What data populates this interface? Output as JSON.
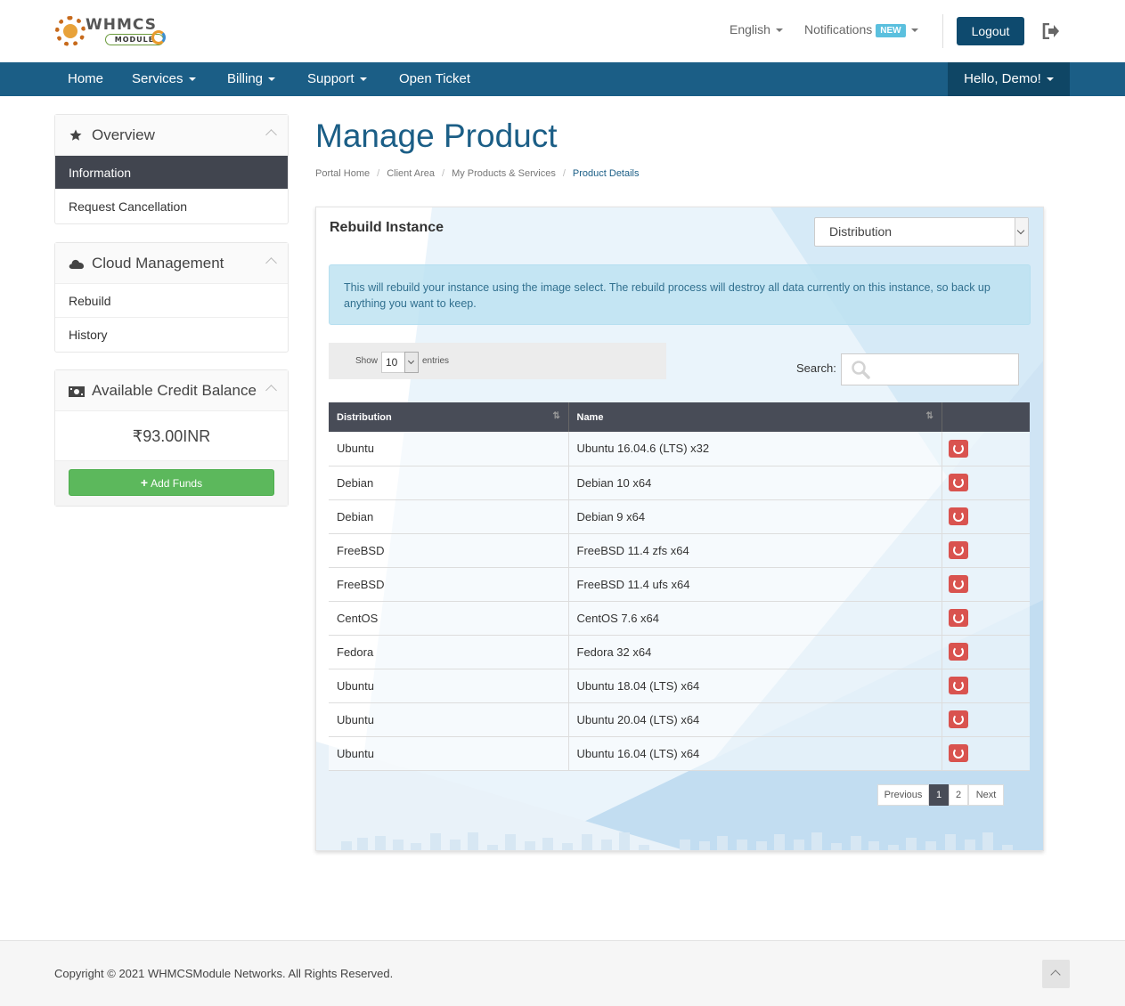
{
  "header": {
    "logo_text": "WHMCS",
    "logo_sub": "MODULE",
    "language": "English",
    "notifications_label": "Notifications",
    "notifications_badge": "NEW",
    "logout_label": "Logout"
  },
  "nav": {
    "items": [
      {
        "label": "Home",
        "dropdown": false
      },
      {
        "label": "Services",
        "dropdown": true
      },
      {
        "label": "Billing",
        "dropdown": true
      },
      {
        "label": "Support",
        "dropdown": true
      },
      {
        "label": "Open Ticket",
        "dropdown": false
      }
    ],
    "user_label": "Hello, Demo!"
  },
  "sidebar": {
    "overview": {
      "title": "Overview",
      "items": [
        "Information",
        "Request Cancellation"
      ],
      "active": "Information"
    },
    "cloud": {
      "title": "Cloud Management",
      "items": [
        "Rebuild",
        "History"
      ]
    },
    "credit": {
      "title": "Available Credit Balance",
      "amount": "₹93.00INR",
      "add_funds_label": "Add Funds"
    }
  },
  "main": {
    "title": "Manage Product",
    "breadcrumb": [
      "Portal Home",
      "Client Area",
      "My Products & Services",
      "Product Details"
    ],
    "card": {
      "title": "Rebuild Instance",
      "distribution_select": "Distribution",
      "alert": "This will rebuild your instance using the image select. The rebuild process will destroy all data currently on this instance, so back up anything you want to keep.",
      "length": {
        "show": "Show",
        "value": "10",
        "entries": "entries"
      },
      "search_label": "Search:",
      "columns": [
        "Distribution",
        "Name",
        ""
      ],
      "rows": [
        {
          "distribution": "Ubuntu",
          "name": "Ubuntu 16.04.6 (LTS) x32"
        },
        {
          "distribution": "Debian",
          "name": "Debian 10 x64"
        },
        {
          "distribution": "Debian",
          "name": "Debian 9 x64"
        },
        {
          "distribution": "FreeBSD",
          "name": "FreeBSD 11.4 zfs x64"
        },
        {
          "distribution": "FreeBSD",
          "name": "FreeBSD 11.4 ufs x64"
        },
        {
          "distribution": "CentOS",
          "name": "CentOS 7.6 x64"
        },
        {
          "distribution": "Fedora",
          "name": "Fedora 32 x64"
        },
        {
          "distribution": "Ubuntu",
          "name": "Ubuntu 18.04 (LTS) x64"
        },
        {
          "distribution": "Ubuntu",
          "name": "Ubuntu 20.04 (LTS) x64"
        },
        {
          "distribution": "Ubuntu",
          "name": "Ubuntu 16.04 (LTS) x64"
        }
      ],
      "pagination": {
        "previous": "Previous",
        "pages": [
          "1",
          "2"
        ],
        "current": "1",
        "next": "Next"
      }
    }
  },
  "footer": {
    "copyright": "Copyright © 2021 WHMCSModule Networks. All Rights Reserved."
  },
  "colors": {
    "primary": "#1b5e86",
    "nav_dark": "#0f4665",
    "table_header": "#484c57",
    "danger": "#d9534f",
    "success": "#5cb85c",
    "info_bg": "#d9edf7",
    "badge": "#5bc0de"
  }
}
